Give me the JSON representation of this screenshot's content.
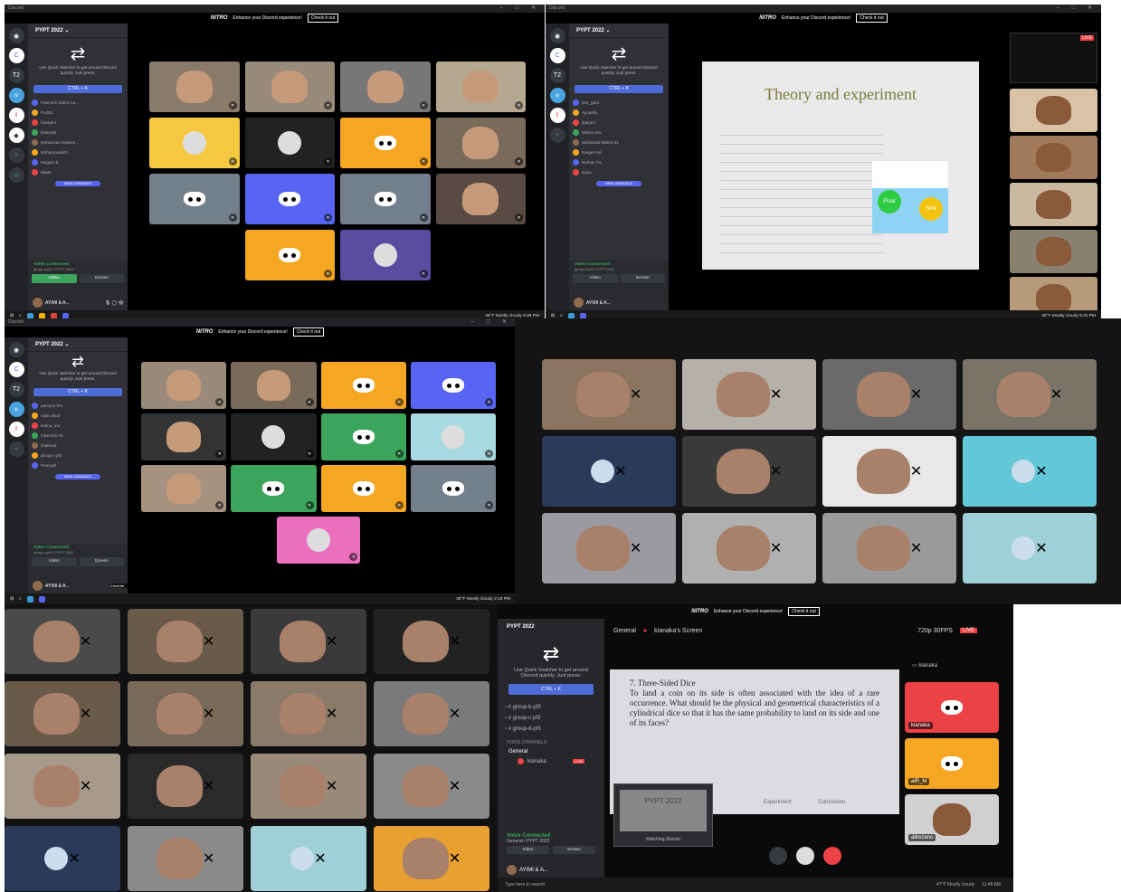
{
  "discord": {
    "window_title": "Discord",
    "server": "PYPT 2022",
    "nitro": "NITRO",
    "nitro_text": "Enhance your Discord experience!",
    "check": "Check it out",
    "qs_text": "Use Quick Switcher to get around Discord quickly. Just press:",
    "ctrl": "CTRL + K",
    "new_unreads": "NEW UNREADS",
    "video_connected": "Video Connected",
    "group_path": "group-a-pf3 / PYPT 2022",
    "video_btn": "Video",
    "screen_btn": "Screen",
    "username": "AYIMI & A...",
    "tag": "#3093",
    "weather": "36°F  Mostly cloudy",
    "date": "2/17/2022"
  },
  "panel1": {
    "users": [
      "Fatemeh Zahra Sa...",
      "FAZEL",
      "hossaini",
      "kastanbr",
      "Mohamad.Hossien...",
      "MohammadKh",
      "Mogam.b",
      "Nikah"
    ],
    "time": "6:08 PM"
  },
  "panel2": {
    "users": [
      "ven_gara",
      "Ayuarifa",
      "jhpirani",
      "Melina Ma",
      "Mohamad Malek-31",
      "Narges Ne",
      "Borhan Fa",
      "Sana"
    ],
    "slide_title": "Theory and experiment",
    "float": "Float",
    "sink": "Sink",
    "live": "LIVE",
    "time": "6:31 PM"
  },
  "panel3": {
    "users": [
      "parvyan.RA",
      "mjan.abod",
      "salma_ma",
      "Fatemeh Ya",
      "shahvad",
      "group-c-pf2",
      "Pouryaft"
    ],
    "live": "LIVE",
    "unmute": "Unmute",
    "time": "2:19 PM"
  },
  "panel6": {
    "server": "PYPT 2022",
    "channel": "General",
    "stream": "kianaka's Screen",
    "quality": "720p 30FPS",
    "live": "LIVE",
    "problem_title": "7. Three-Sided Dice",
    "problem_text": "To land a coin on its side is often associated with the idea of a rare occurrence. What should be the physical and geometrical characteristics of a cylindrical dice so that it has the same probability to land on its side and one of its faces?",
    "channels": [
      "group-b-pf3",
      "group-c-pf3",
      "group-d-pf3"
    ],
    "voice_channels": "VOICE CHANNELS",
    "general": "General",
    "member": "kianaka",
    "voice_connected": "Voice Connected",
    "voice_path": "General / PYPT 2022",
    "watching": "Watching Stream",
    "pip_title": "PYPT 2022",
    "side_user": "kianaka",
    "tiles": [
      "kianaka",
      "alR_M",
      "alirezano"
    ],
    "tabs": [
      "Experiment",
      "Conclusion"
    ],
    "search": "Type here to search",
    "weather": "47°F  Mostly cloudy",
    "time": "11:46 AM",
    "username": "AYIMI & A...",
    "tag": "#3093",
    "video_btn": "Video",
    "screen_btn": "Screen"
  }
}
